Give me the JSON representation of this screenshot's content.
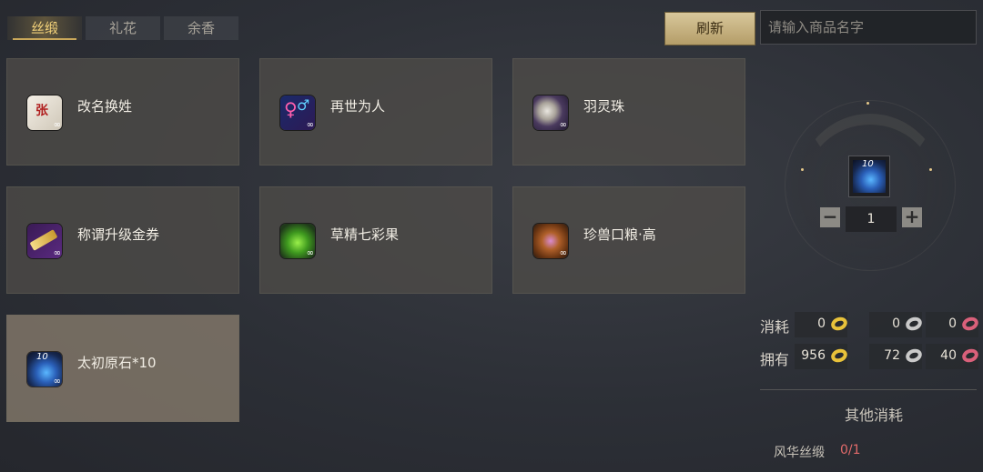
{
  "tabs": [
    "丝缎",
    "礼花",
    "余香"
  ],
  "active_tab": 0,
  "items": [
    {
      "name": "改名换姓",
      "icon": "mahjong-tile-icon"
    },
    {
      "name": "再世为人",
      "icon": "gender-symbol-icon"
    },
    {
      "name": "羽灵珠",
      "icon": "pearl-icon"
    },
    {
      "name": "称谓升级金券",
      "icon": "golden-ticket-icon"
    },
    {
      "name": "草精七彩果",
      "icon": "green-fruit-icon"
    },
    {
      "name": "珍兽口粮·高",
      "icon": "pet-food-icon"
    },
    {
      "name": "太初原石*10",
      "icon": "blue-crystal-icon",
      "badge": "10",
      "selected": true
    }
  ],
  "infinity_symbol": "∞",
  "refresh_label": "刷新",
  "search_placeholder": "请输入商品名字",
  "selected_item": {
    "badge": "10",
    "icon": "blue-crystal-icon"
  },
  "quantity": "1",
  "minus": "−",
  "plus": "+",
  "consume": {
    "label": "消耗",
    "gold": "0",
    "silver": "0",
    "pink": "0"
  },
  "own": {
    "label": "拥有",
    "gold": "956",
    "silver": "72",
    "pink": "40"
  },
  "other_cost": {
    "title": "其他消耗",
    "item": "风华丝缎",
    "value": "0/1"
  },
  "colors": {
    "accent": "#f3d27a",
    "gold_coin": "#e8c23a",
    "silver_coin": "#c9c9c9",
    "pink_coin": "#d9607a",
    "warning": "#e06a6a"
  }
}
